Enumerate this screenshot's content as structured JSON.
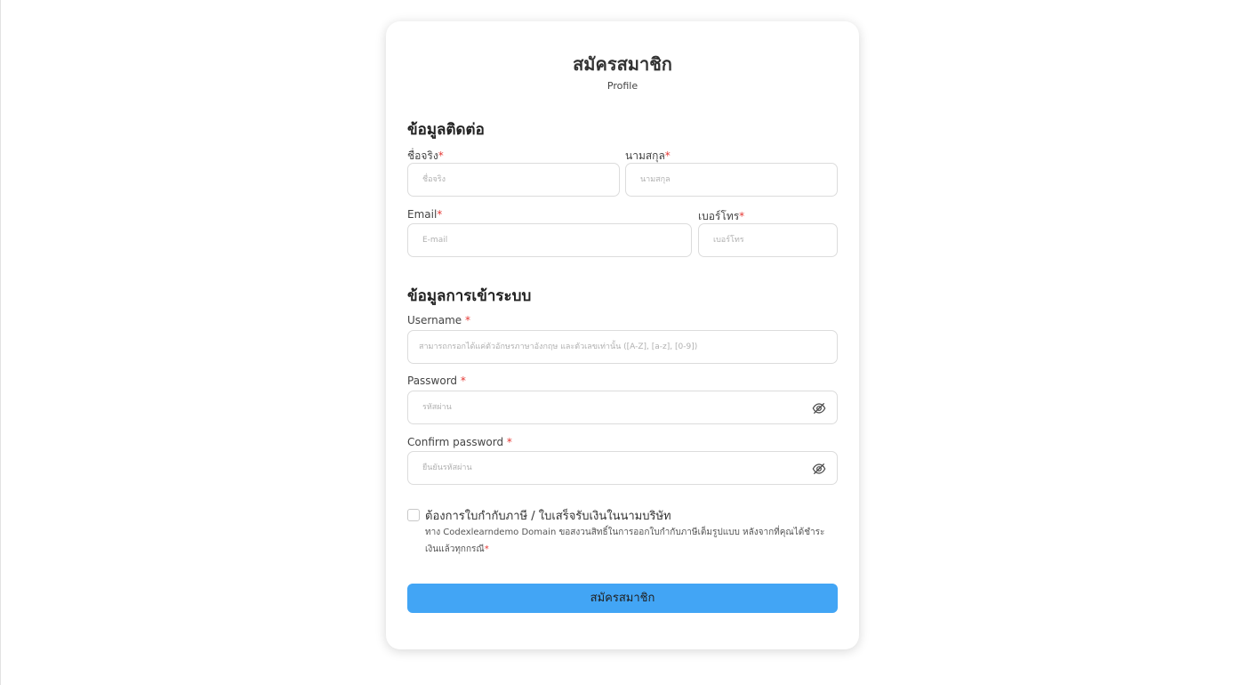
{
  "form": {
    "title": "สมัครสมาชิก",
    "subtitle": "Profile",
    "required_mark": "*"
  },
  "contact": {
    "heading": "ข้อมูลติดต่อ",
    "first_name": {
      "label": "ชื่อจริง",
      "placeholder": "ชื่อจริง",
      "value": ""
    },
    "last_name": {
      "label": "นามสกุล",
      "placeholder": "นามสกุล",
      "value": ""
    },
    "email": {
      "label": "Email",
      "placeholder": "E-mail",
      "value": ""
    },
    "phone": {
      "label": "เบอร์โทร",
      "placeholder": "เบอร์โทร",
      "value": ""
    }
  },
  "login": {
    "heading": "ข้อมูลการเข้าระบบ",
    "username": {
      "label": "Username ",
      "placeholder": "สามารถกรอกได้แค่ตัวอักษรภาษาอังกฤษ และตัวเลขเท่านั้น ([A-Z], [a-z], [0-9])",
      "value": ""
    },
    "password": {
      "label": "Password ",
      "placeholder": "รหัสผ่าน",
      "value": "",
      "icon": "eye-slash-icon"
    },
    "confirm_password": {
      "label": "Confirm password ",
      "placeholder": "ยืนยันรหัสผ่าน",
      "value": "",
      "icon": "eye-slash-icon"
    }
  },
  "invoice": {
    "checked": false,
    "label": "ต้องการใบกำกับภาษี / ใบเสร็จรับเงินในนามบริษัท",
    "note": "ทาง Codexlearndemo Domain ขอสงวนสิทธิ์ในการออกใบกำกับภาษีเต็มรูปแบบ หลังจากที่คุณได้ชำระเงินแล้วทุกกรณี"
  },
  "submit": {
    "label": "สมัครสมาชิก"
  },
  "colors": {
    "accent": "#42a5f5",
    "required": "#e53935",
    "border": "#dcdcdc"
  }
}
